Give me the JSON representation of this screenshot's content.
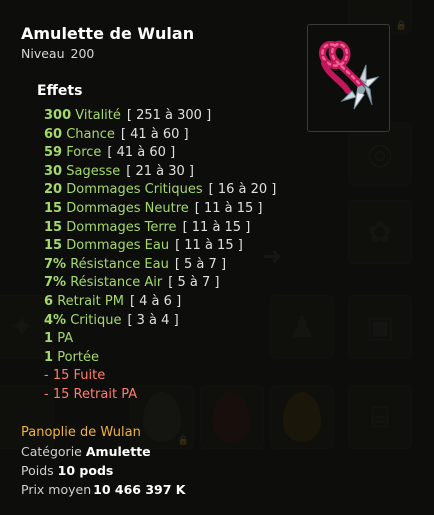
{
  "item": {
    "name": "Amulette de Wulan",
    "level_label": "Niveau",
    "level_value": "200",
    "image_icon": "wulan-amulet-icon"
  },
  "effects_title": "Effets",
  "effects": [
    {
      "value": "300",
      "name": "Vitalité",
      "range": "[ 251 à 300 ]",
      "type": "positive"
    },
    {
      "value": "60",
      "name": "Chance",
      "range": "[ 41 à 60 ]",
      "type": "positive"
    },
    {
      "value": "59",
      "name": "Force",
      "range": "[ 41 à 60 ]",
      "type": "positive"
    },
    {
      "value": "30",
      "name": "Sagesse",
      "range": "[ 21 à 30 ]",
      "type": "positive"
    },
    {
      "value": "20",
      "name": "Dommages Critiques",
      "range": "[ 16 à 20 ]",
      "type": "positive"
    },
    {
      "value": "15",
      "name": "Dommages Neutre",
      "range": "[ 11 à 15 ]",
      "type": "positive"
    },
    {
      "value": "15",
      "name": "Dommages Terre",
      "range": "[ 11 à 15 ]",
      "type": "positive"
    },
    {
      "value": "15",
      "name": "Dommages Eau",
      "range": "[ 11 à 15 ]",
      "type": "positive"
    },
    {
      "value": "7%",
      "name": "Résistance Eau",
      "range": "[ 5 à 7 ]",
      "type": "positive"
    },
    {
      "value": "7%",
      "name": "Résistance Air",
      "range": "[ 5 à 7 ]",
      "type": "positive"
    },
    {
      "value": "6",
      "name": "Retrait PM",
      "range": "[ 4 à 6 ]",
      "type": "positive"
    },
    {
      "value": "4%",
      "name": "Critique",
      "range": "[ 3 à 4 ]",
      "type": "positive"
    },
    {
      "value": "1",
      "name": "PA",
      "range": "",
      "type": "positive"
    },
    {
      "value": "1",
      "name": "Portée",
      "range": "",
      "type": "positive"
    },
    {
      "value": "- 15",
      "name": "Fuite",
      "range": "",
      "type": "negative"
    },
    {
      "value": "- 15",
      "name": "Retrait PA",
      "range": "",
      "type": "negative"
    }
  ],
  "panoplie": "Panoplie de Wulan",
  "meta": {
    "category_label": "Catégorie",
    "category_value": "Amulette",
    "weight_label": "Poids",
    "weight_value": "10 pods",
    "price_label": "Prix moyen",
    "price_value": "10 466 397 K"
  },
  "colors": {
    "positive": "#a6d96a",
    "negative": "#ff7e6b",
    "panoplie": "#f0b43c",
    "background": "#141512"
  }
}
